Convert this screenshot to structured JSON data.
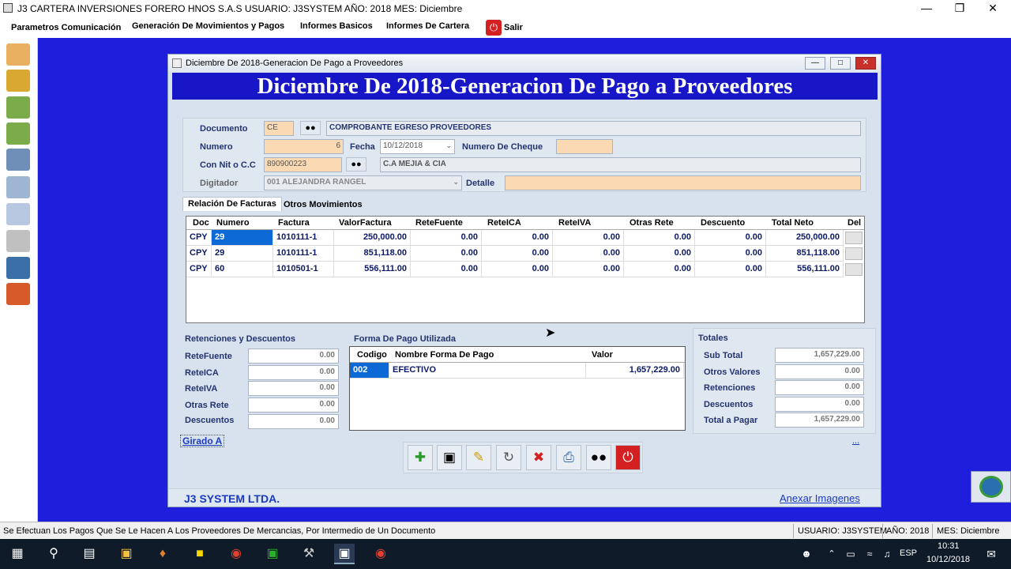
{
  "app": {
    "title": "J3 CARTERA INVERSIONES FORERO HNOS S.A.S USUARIO: J3SYSTEM AÑO: 2018 MES: Diciembre"
  },
  "menu": {
    "items": [
      "Parametros Comunicación",
      "Generación De Movimientos y Pagos",
      "Informes Basicos",
      "Informes De Cartera"
    ],
    "exit": "Salir"
  },
  "window": {
    "title": "Diciembre De 2018-Generacion De Pago a Proveedores",
    "banner": "Diciembre De 2018-Generacion De Pago a Proveedores"
  },
  "form": {
    "documento_label": "Documento",
    "documento_value": "CE",
    "documento_desc": "COMPROBANTE EGRESO PROVEEDORES",
    "numero_label": "Numero",
    "numero_value": "6",
    "fecha_label": "Fecha",
    "fecha_value": "10/12/2018",
    "cheque_label": "Numero De Cheque",
    "cheque_value": "",
    "nit_label": "Con Nit o C.C",
    "nit_value": "890900223",
    "nit_desc": "C.A MEJIA & CIA",
    "digitador_label": "Digitador",
    "digitador_value": "001    ALEJANDRA RANGEL",
    "detalle_label": "Detalle",
    "detalle_value": ""
  },
  "tabs": [
    "Relación De Facturas",
    "Otros Movimientos"
  ],
  "grid": {
    "headers": [
      "Doc",
      "Numero",
      "Factura",
      "ValorFactura",
      "ReteFuente",
      "ReteICA",
      "ReteIVA",
      "Otras Rete",
      "Descuento",
      "Total Neto",
      "Del"
    ],
    "rows": [
      [
        "CPY",
        "29",
        "1010111-1",
        "250,000.00",
        "0.00",
        "0.00",
        "0.00",
        "0.00",
        "0.00",
        "250,000.00"
      ],
      [
        "CPY",
        "29",
        "1010111-1",
        "851,118.00",
        "0.00",
        "0.00",
        "0.00",
        "0.00",
        "0.00",
        "851,118.00"
      ],
      [
        "CPY",
        "60",
        "1010501-1",
        "556,111.00",
        "0.00",
        "0.00",
        "0.00",
        "0.00",
        "0.00",
        "556,111.00"
      ]
    ]
  },
  "retenciones": {
    "title": "Retenciones y Descuentos",
    "items": [
      {
        "label": "ReteFuente",
        "value": "0.00"
      },
      {
        "label": "ReteICA",
        "value": "0.00"
      },
      {
        "label": "ReteIVA",
        "value": "0.00"
      },
      {
        "label": "Otras Rete",
        "value": "0.00"
      },
      {
        "label": "Descuentos",
        "value": "0.00"
      }
    ]
  },
  "forma_pago": {
    "title": "Forma De Pago Utilizada",
    "headers": [
      "Codigo",
      "Nombre Forma De Pago",
      "Valor"
    ],
    "rows": [
      [
        "002",
        "EFECTIVO",
        "1,657,229.00"
      ]
    ]
  },
  "totales": {
    "title": "Totales",
    "items": [
      {
        "label": "Sub Total",
        "value": "1,657,229.00"
      },
      {
        "label": "Otros Valores",
        "value": "0.00"
      },
      {
        "label": "Retenciones",
        "value": "0.00"
      },
      {
        "label": "Descuentos",
        "value": "0.00"
      },
      {
        "label": "Total a Pagar",
        "value": "1,657,229.00"
      }
    ]
  },
  "girado": "Girado A",
  "dots": "...",
  "footer": {
    "company": "J3 SYSTEM LTDA.",
    "link": "Anexar Imagenes"
  },
  "status": {
    "message": "Se Efectuan Los Pagos Que Se Le Hacen A Los Proveedores De Mercancias, Por Intermedio de Un Documento",
    "user": "USUARIO: J3SYSTEM",
    "year": "AÑO: 2018",
    "month": "MES: Diciembre"
  },
  "taskbar": {
    "lang": "ESP",
    "time": "10:31",
    "date": "10/12/2018"
  },
  "colors": {
    "banner": "#1717c8",
    "desktop": "#1e1edc",
    "selected": "#0c69d6"
  }
}
